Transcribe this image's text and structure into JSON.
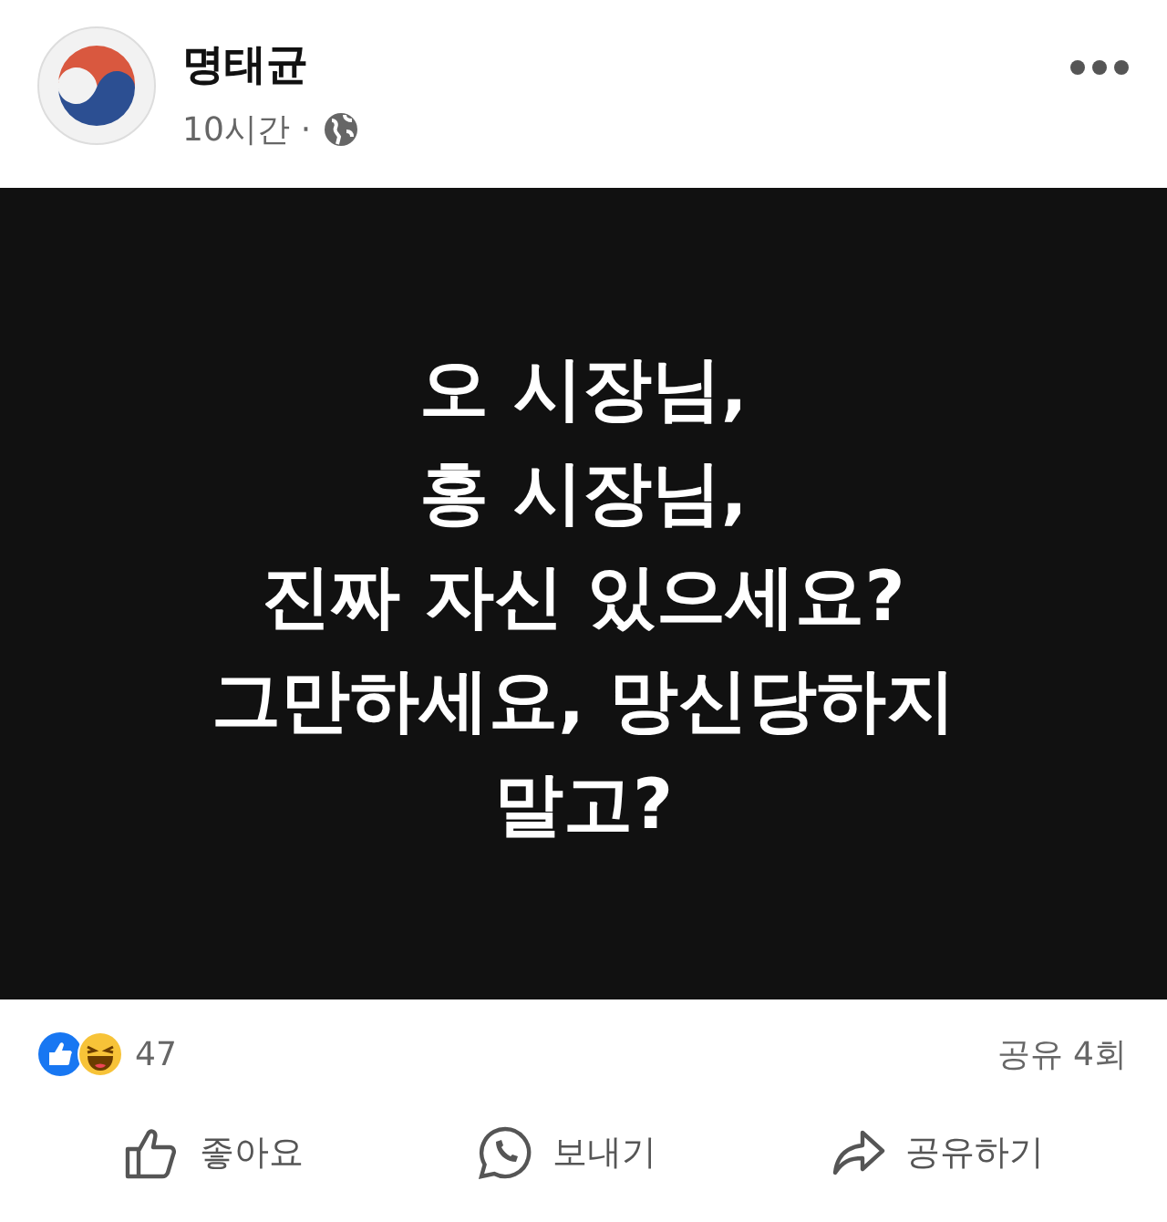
{
  "post": {
    "author": "명태균",
    "time": "10시간",
    "separator": "·",
    "image_lines": [
      "오 시장님,",
      "홍 시장님,",
      "진짜 자신 있으세요?",
      "그만하세요, 망신당하지",
      "말고?"
    ],
    "reactions_count": "47",
    "shares": "공유 4회",
    "actions": [
      {
        "kind": "like",
        "label": "좋아요"
      },
      {
        "kind": "send",
        "label": "보내기"
      },
      {
        "kind": "share",
        "label": "공유하기"
      }
    ]
  }
}
